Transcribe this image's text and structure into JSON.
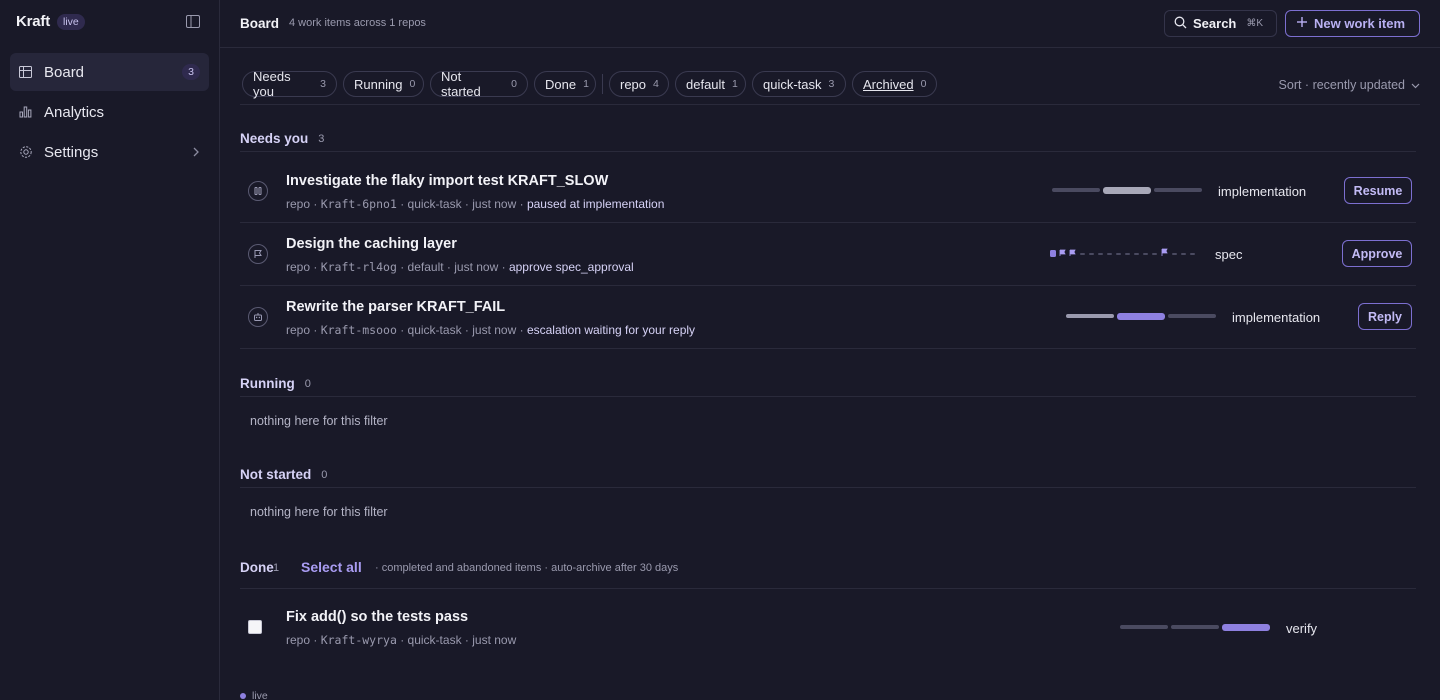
{
  "app": {
    "name": "Kraft",
    "badge": "live"
  },
  "sidebar": {
    "items": [
      {
        "label": "Board",
        "count": "3"
      },
      {
        "label": "Analytics"
      },
      {
        "label": "Settings"
      }
    ]
  },
  "header": {
    "title": "Board",
    "subtitle": "4 work items across 1 repos",
    "search_label": "Search",
    "search_shortcut": "⌘K",
    "new_label": "New work item"
  },
  "filters": {
    "chips": [
      {
        "label": "Needs you",
        "count": "3"
      },
      {
        "label": "Running",
        "count": "0"
      },
      {
        "label": "Not started",
        "count": "0"
      },
      {
        "label": "Done",
        "count": "1"
      },
      {
        "label": "repo",
        "count": "4"
      },
      {
        "label": "default",
        "count": "1"
      },
      {
        "label": "quick-task",
        "count": "3"
      },
      {
        "label": "Archived",
        "count": "0"
      }
    ],
    "sort_label": "Sort · recently updated"
  },
  "sections": {
    "needs_you": {
      "title": "Needs you",
      "count": "3",
      "items": [
        {
          "title": "Investigate the flaky import test KRAFT_SLOW",
          "repo": "repo",
          "id": "Kraft-6pno1",
          "type": "quick-task",
          "time": "just now",
          "status": "paused at implementation",
          "stage": "implementation",
          "action": "Resume",
          "icon": "pause-icon"
        },
        {
          "title": "Design the caching layer",
          "repo": "repo",
          "id": "Kraft-rl4og",
          "type": "default",
          "time": "just now",
          "status": "approve spec_approval",
          "stage": "spec",
          "action": "Approve",
          "icon": "flag-icon"
        },
        {
          "title": "Rewrite the parser KRAFT_FAIL",
          "repo": "repo",
          "id": "Kraft-msooo",
          "type": "quick-task",
          "time": "just now",
          "status": "escalation waiting for your reply",
          "stage": "implementation",
          "action": "Reply",
          "icon": "robot-icon"
        }
      ]
    },
    "running": {
      "title": "Running",
      "count": "0",
      "empty": "nothing here for this filter"
    },
    "not_started": {
      "title": "Not started",
      "count": "0",
      "empty": "nothing here for this filter"
    },
    "done": {
      "title": "Done",
      "count": "1",
      "select_all": "Select all",
      "note": "· completed and abandoned items · auto-archive after 30 days",
      "items": [
        {
          "title": "Fix add() so the tests pass",
          "repo": "repo",
          "id": "Kraft-wyrya",
          "type": "quick-task",
          "time": "just now",
          "stage": "verify"
        }
      ]
    }
  },
  "footer": {
    "status": "live"
  },
  "colors": {
    "accent": "#8e80e0",
    "background": "#191928"
  }
}
